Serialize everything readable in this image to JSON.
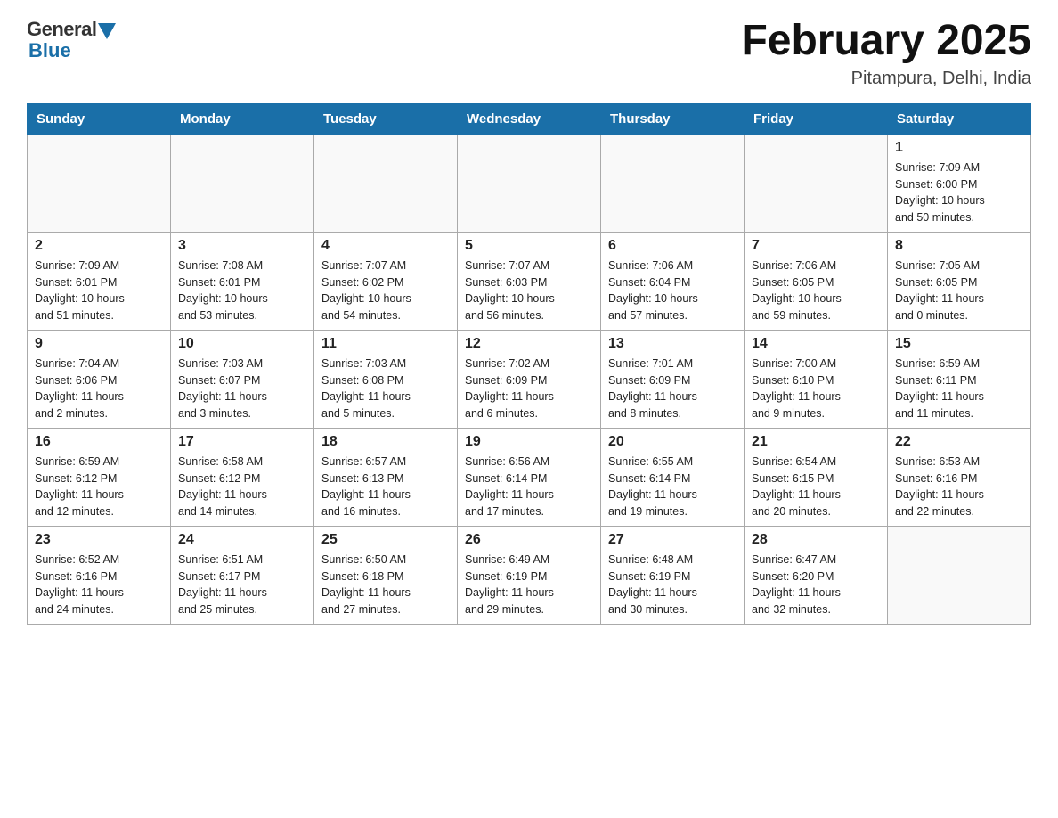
{
  "header": {
    "logo_general": "General",
    "logo_blue": "Blue",
    "title": "February 2025",
    "subtitle": "Pitampura, Delhi, India"
  },
  "days_of_week": [
    "Sunday",
    "Monday",
    "Tuesday",
    "Wednesday",
    "Thursday",
    "Friday",
    "Saturday"
  ],
  "weeks": [
    [
      {
        "day": "",
        "info": ""
      },
      {
        "day": "",
        "info": ""
      },
      {
        "day": "",
        "info": ""
      },
      {
        "day": "",
        "info": ""
      },
      {
        "day": "",
        "info": ""
      },
      {
        "day": "",
        "info": ""
      },
      {
        "day": "1",
        "info": "Sunrise: 7:09 AM\nSunset: 6:00 PM\nDaylight: 10 hours\nand 50 minutes."
      }
    ],
    [
      {
        "day": "2",
        "info": "Sunrise: 7:09 AM\nSunset: 6:01 PM\nDaylight: 10 hours\nand 51 minutes."
      },
      {
        "day": "3",
        "info": "Sunrise: 7:08 AM\nSunset: 6:01 PM\nDaylight: 10 hours\nand 53 minutes."
      },
      {
        "day": "4",
        "info": "Sunrise: 7:07 AM\nSunset: 6:02 PM\nDaylight: 10 hours\nand 54 minutes."
      },
      {
        "day": "5",
        "info": "Sunrise: 7:07 AM\nSunset: 6:03 PM\nDaylight: 10 hours\nand 56 minutes."
      },
      {
        "day": "6",
        "info": "Sunrise: 7:06 AM\nSunset: 6:04 PM\nDaylight: 10 hours\nand 57 minutes."
      },
      {
        "day": "7",
        "info": "Sunrise: 7:06 AM\nSunset: 6:05 PM\nDaylight: 10 hours\nand 59 minutes."
      },
      {
        "day": "8",
        "info": "Sunrise: 7:05 AM\nSunset: 6:05 PM\nDaylight: 11 hours\nand 0 minutes."
      }
    ],
    [
      {
        "day": "9",
        "info": "Sunrise: 7:04 AM\nSunset: 6:06 PM\nDaylight: 11 hours\nand 2 minutes."
      },
      {
        "day": "10",
        "info": "Sunrise: 7:03 AM\nSunset: 6:07 PM\nDaylight: 11 hours\nand 3 minutes."
      },
      {
        "day": "11",
        "info": "Sunrise: 7:03 AM\nSunset: 6:08 PM\nDaylight: 11 hours\nand 5 minutes."
      },
      {
        "day": "12",
        "info": "Sunrise: 7:02 AM\nSunset: 6:09 PM\nDaylight: 11 hours\nand 6 minutes."
      },
      {
        "day": "13",
        "info": "Sunrise: 7:01 AM\nSunset: 6:09 PM\nDaylight: 11 hours\nand 8 minutes."
      },
      {
        "day": "14",
        "info": "Sunrise: 7:00 AM\nSunset: 6:10 PM\nDaylight: 11 hours\nand 9 minutes."
      },
      {
        "day": "15",
        "info": "Sunrise: 6:59 AM\nSunset: 6:11 PM\nDaylight: 11 hours\nand 11 minutes."
      }
    ],
    [
      {
        "day": "16",
        "info": "Sunrise: 6:59 AM\nSunset: 6:12 PM\nDaylight: 11 hours\nand 12 minutes."
      },
      {
        "day": "17",
        "info": "Sunrise: 6:58 AM\nSunset: 6:12 PM\nDaylight: 11 hours\nand 14 minutes."
      },
      {
        "day": "18",
        "info": "Sunrise: 6:57 AM\nSunset: 6:13 PM\nDaylight: 11 hours\nand 16 minutes."
      },
      {
        "day": "19",
        "info": "Sunrise: 6:56 AM\nSunset: 6:14 PM\nDaylight: 11 hours\nand 17 minutes."
      },
      {
        "day": "20",
        "info": "Sunrise: 6:55 AM\nSunset: 6:14 PM\nDaylight: 11 hours\nand 19 minutes."
      },
      {
        "day": "21",
        "info": "Sunrise: 6:54 AM\nSunset: 6:15 PM\nDaylight: 11 hours\nand 20 minutes."
      },
      {
        "day": "22",
        "info": "Sunrise: 6:53 AM\nSunset: 6:16 PM\nDaylight: 11 hours\nand 22 minutes."
      }
    ],
    [
      {
        "day": "23",
        "info": "Sunrise: 6:52 AM\nSunset: 6:16 PM\nDaylight: 11 hours\nand 24 minutes."
      },
      {
        "day": "24",
        "info": "Sunrise: 6:51 AM\nSunset: 6:17 PM\nDaylight: 11 hours\nand 25 minutes."
      },
      {
        "day": "25",
        "info": "Sunrise: 6:50 AM\nSunset: 6:18 PM\nDaylight: 11 hours\nand 27 minutes."
      },
      {
        "day": "26",
        "info": "Sunrise: 6:49 AM\nSunset: 6:19 PM\nDaylight: 11 hours\nand 29 minutes."
      },
      {
        "day": "27",
        "info": "Sunrise: 6:48 AM\nSunset: 6:19 PM\nDaylight: 11 hours\nand 30 minutes."
      },
      {
        "day": "28",
        "info": "Sunrise: 6:47 AM\nSunset: 6:20 PM\nDaylight: 11 hours\nand 32 minutes."
      },
      {
        "day": "",
        "info": ""
      }
    ]
  ]
}
